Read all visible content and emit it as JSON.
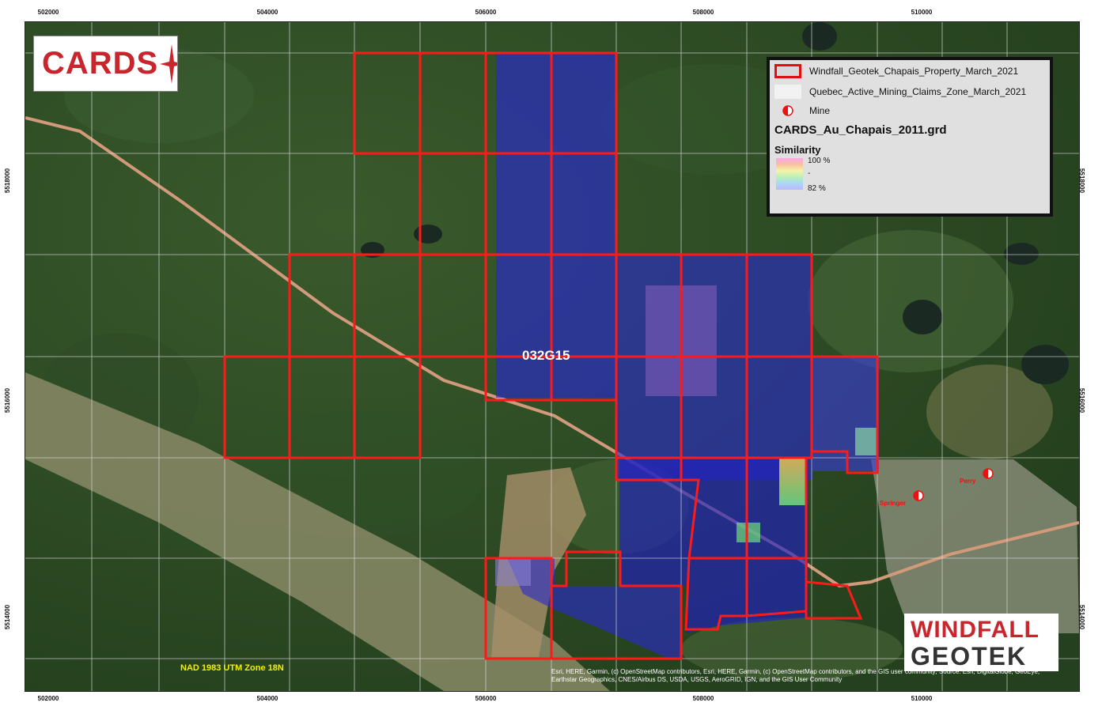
{
  "map": {
    "grid_labels_x": [
      "502000",
      "504000",
      "506000",
      "508000",
      "510000"
    ],
    "grid_labels_y": [
      "5518000",
      "5516000",
      "5514000"
    ],
    "sheet_label": "032G15",
    "crs_label": "NAD 1983 UTM Zone 18N",
    "credits": "Esri, HERE, Garmin, (c) OpenStreetMap contributors, Esri, HERE, Garmin, (c) OpenStreetMap contributors, and the GIS user community; Source: Esri, DigitalGlobe, GeoEye, Earthstar Geographics, CNES/Airbus DS, USDA, USGS, AeroGRID, IGN, and the GIS User Community",
    "towns": [
      "Springer",
      "Perry"
    ]
  },
  "logos": {
    "cards": "CARDS",
    "windfall_line1": "WINDFALL",
    "windfall_line2": "GEOTEK"
  },
  "legend": {
    "items": [
      {
        "label": "Windfall_Geotek_Chapais_Property_March_2021",
        "icon": "red-outline-box"
      },
      {
        "label": "Quebec_Active_Mining_Claims_Zone_March_2021",
        "icon": "white-box"
      },
      {
        "label": "Mine",
        "icon": "half-circle-mine-icon"
      }
    ],
    "grid_title": "CARDS_Au_Chapais_2011.grd",
    "similarity_title": "Similarity",
    "sim_max": "100 %",
    "sim_mid": "-",
    "sim_min": "82 %"
  },
  "colors": {
    "claim_outline": "#ff1a1a",
    "similarity_fill": "#2a2ad0",
    "forest": "#2c4a24",
    "road": "#d19a7a"
  }
}
